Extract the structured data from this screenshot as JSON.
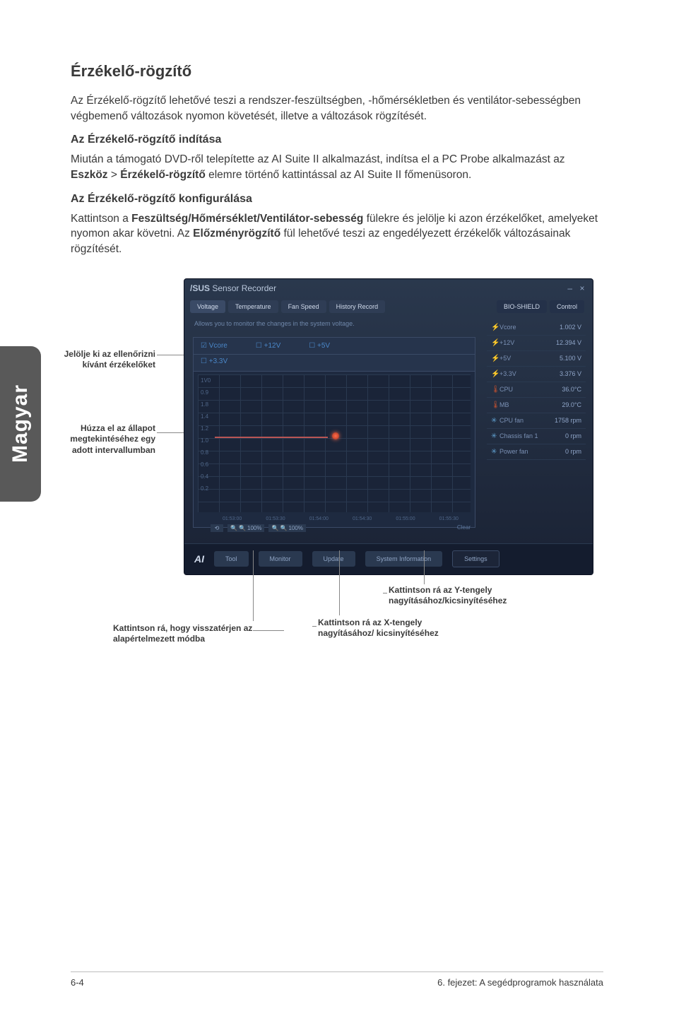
{
  "side_tab": "Magyar",
  "heading": "Érzékelő-rögzítő",
  "intro": "Az Érzékelő-rögzítő lehetővé teszi a rendszer-feszültségben, -hőmérsékletben és ventilátor-sebességben végbemenő változások nyomon követését, illetve a változások rögzítését.",
  "sub1_heading": "Az Érzékelő-rögzítő indítása",
  "sub1_body_pre": "Miután a támogató DVD-ről telepítette az AI Suite II alkalmazást, indítsa el a PC Probe alkalmazást az ",
  "sub1_menu1": "Eszköz",
  "sub1_sep": " > ",
  "sub1_menu2": "Érzékelő-rögzítő",
  "sub1_body_post": " elemre történő kattintással az AI Suite II főmenüsoron.",
  "sub2_heading": "Az Érzékelő-rögzítő konfigurálása",
  "sub2_body_pre": "Kattintson a ",
  "sub2_bold1": "Feszültség/Hőmérséklet/Ventilátor-sebesség",
  "sub2_mid": " fülekre és jelölje ki azon érzékelőket, amelyeket nyomon akar követni. Az ",
  "sub2_bold2": "Előzményrögzítő",
  "sub2_post": " fül lehetővé teszi az engedélyezett érzékelők változásainak rögzítését.",
  "captions": {
    "select_sensors": "Jelölje ki az ellenőrizni kívánt érzékelőket",
    "drag_status": "Húzza el az állapot megtekintéséhez egy adott intervallumban",
    "zoom_y": "Kattintson rá az Y-tengely nagyításához/kicsinyítéséhez",
    "zoom_x": "Kattintson rá az X-tengely nagyításához/ kicsinyítéséhez",
    "reset": "Kattintson rá, hogy visszatérjen az alapértelmezett módba"
  },
  "app": {
    "title_brand": "/SUS",
    "title_text": "Sensor Recorder",
    "min": "–",
    "close": "×",
    "tabs": [
      "Voltage",
      "Temperature",
      "Fan Speed",
      "History Record"
    ],
    "bio": [
      "BIO-SHIELD",
      "Control"
    ],
    "info": "Allows you to monitor the changes in the system voltage.",
    "checks": [
      "Vcore",
      "+12V",
      "+5V"
    ],
    "checks2": "+3.3V",
    "y_labels": [
      "1V0",
      "0.9",
      "1.8",
      "1.4",
      "1.2",
      "1.0",
      "0.8",
      "0.6",
      "0.4",
      "0.2"
    ],
    "times": [
      "01:53:00",
      "01:53:30",
      "01:54:00",
      "01:54:30",
      "01:55:00",
      "01:55:30"
    ],
    "zoom_x_val": "100%",
    "zoom_y_val": "100%",
    "clear": "Clear",
    "sensors": [
      {
        "name": "Vcore",
        "val": "1.002 V",
        "cls": "volt"
      },
      {
        "name": "+12V",
        "val": "12.394 V",
        "cls": "volt"
      },
      {
        "name": "+5V",
        "val": "5.100 V",
        "cls": "volt"
      },
      {
        "name": "+3.3V",
        "val": "3.376 V",
        "cls": "volt"
      },
      {
        "name": "CPU",
        "val": "36.0°C",
        "cls": "temp"
      },
      {
        "name": "MB",
        "val": "29.0°C",
        "cls": "temp"
      },
      {
        "name": "CPU fan",
        "val": "1758 rpm",
        "cls": "fan"
      },
      {
        "name": "Chassis fan 1",
        "val": "0 rpm",
        "cls": "fan"
      },
      {
        "name": "Power fan",
        "val": "0 rpm",
        "cls": "fan"
      }
    ],
    "dock": {
      "logo": "AI",
      "b1": "Tool",
      "b2": "Monitor",
      "b3": "Update",
      "b4": "System Information",
      "b5": "Settings"
    }
  },
  "footer": {
    "left": "6-4",
    "right": "6. fejezet: A segédprogramok használata"
  }
}
